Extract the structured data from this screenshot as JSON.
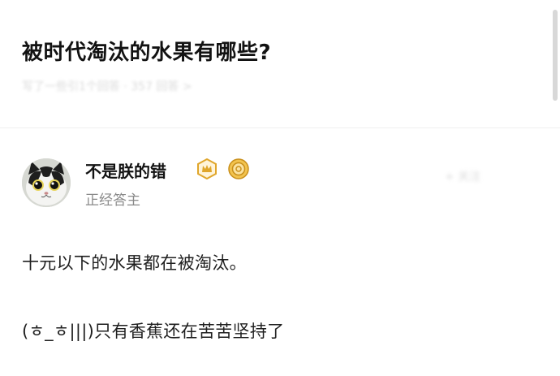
{
  "question": {
    "title": "被时代淘汰的水果有哪些?",
    "faded_meta": "写了一些引1个回答 · 357 回答 >"
  },
  "author": {
    "name": "不是朕的错",
    "subtitle": "正经答主",
    "badges": [
      "crown-badge-icon",
      "coin-badge-icon"
    ],
    "faded_action": "+ 关注"
  },
  "answer": {
    "line1": "十元以下的水果都在被淘汰。",
    "line2": "(ㅎ_ㅎ|||)只有香蕉还在苦苦坚持了"
  },
  "colors": {
    "title": "#121212",
    "subtitle": "#8a8a8a",
    "badge_gold": "#e0a62b",
    "divider": "#efefef"
  }
}
